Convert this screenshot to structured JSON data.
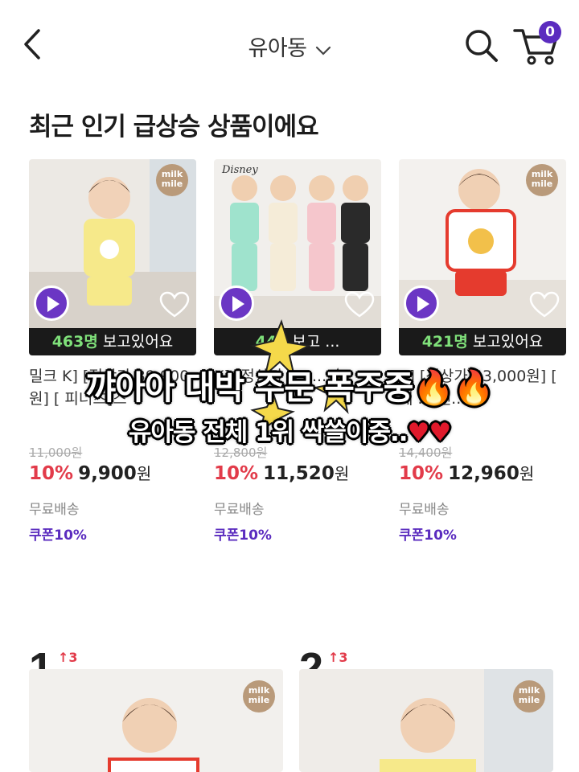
{
  "header": {
    "title": "유아동",
    "cart_count": "0",
    "icons": {
      "back": "back-arrow-icon",
      "dropdown": "chevron-down-icon",
      "search": "search-icon",
      "cart": "cart-icon"
    }
  },
  "section": {
    "title": "최근 인기 급상승 상품이에요"
  },
  "products": [
    {
      "brand": "milk mile",
      "viewer_count": "463명",
      "viewer_suffix": " 보고있어요",
      "name": "밀크 K] [정상가 39,900원] [ 피너츠]스",
      "original_price": "11,000원",
      "discount": "10%",
      "price": "9,900",
      "currency": "원",
      "shipping": "무료배송",
      "coupon": "쿠폰10%"
    },
    {
      "brand": "Disney",
      "viewer_count": "446",
      "viewer_suffix": " 보고 ... ",
      "name": "K] [정상가 45 ...",
      "original_price": "12,800원",
      "discount": "10%",
      "price": "11,520",
      "currency": "원",
      "shipping": "무료배송",
      "coupon": "쿠폰10%"
    },
    {
      "brand": "milk mile",
      "viewer_count": "421명",
      "viewer_suffix": " 보고있어요",
      "name": "K] [정상가 53,000원] [ 베 ... 렌...",
      "original_price": "14,400원",
      "discount": "10%",
      "price": "12,960",
      "currency": "원",
      "shipping": "무료배송",
      "coupon": "쿠폰10%"
    }
  ],
  "caption": {
    "line1": "꺄아아 대박 주문 폭주중",
    "line2": "유아동 전체 1위 싹쓸이중..",
    "fire": "🔥🔥",
    "hearts": "♥♥"
  },
  "ranking": [
    {
      "rank": "1",
      "change": "↑3",
      "brand": "milk mile"
    },
    {
      "rank": "2",
      "change": "↑3",
      "brand": "milk mile"
    }
  ],
  "colors": {
    "accent": "#5b2cbf",
    "sale": "#e23b4a",
    "viewer_highlight": "#7fe07a"
  }
}
